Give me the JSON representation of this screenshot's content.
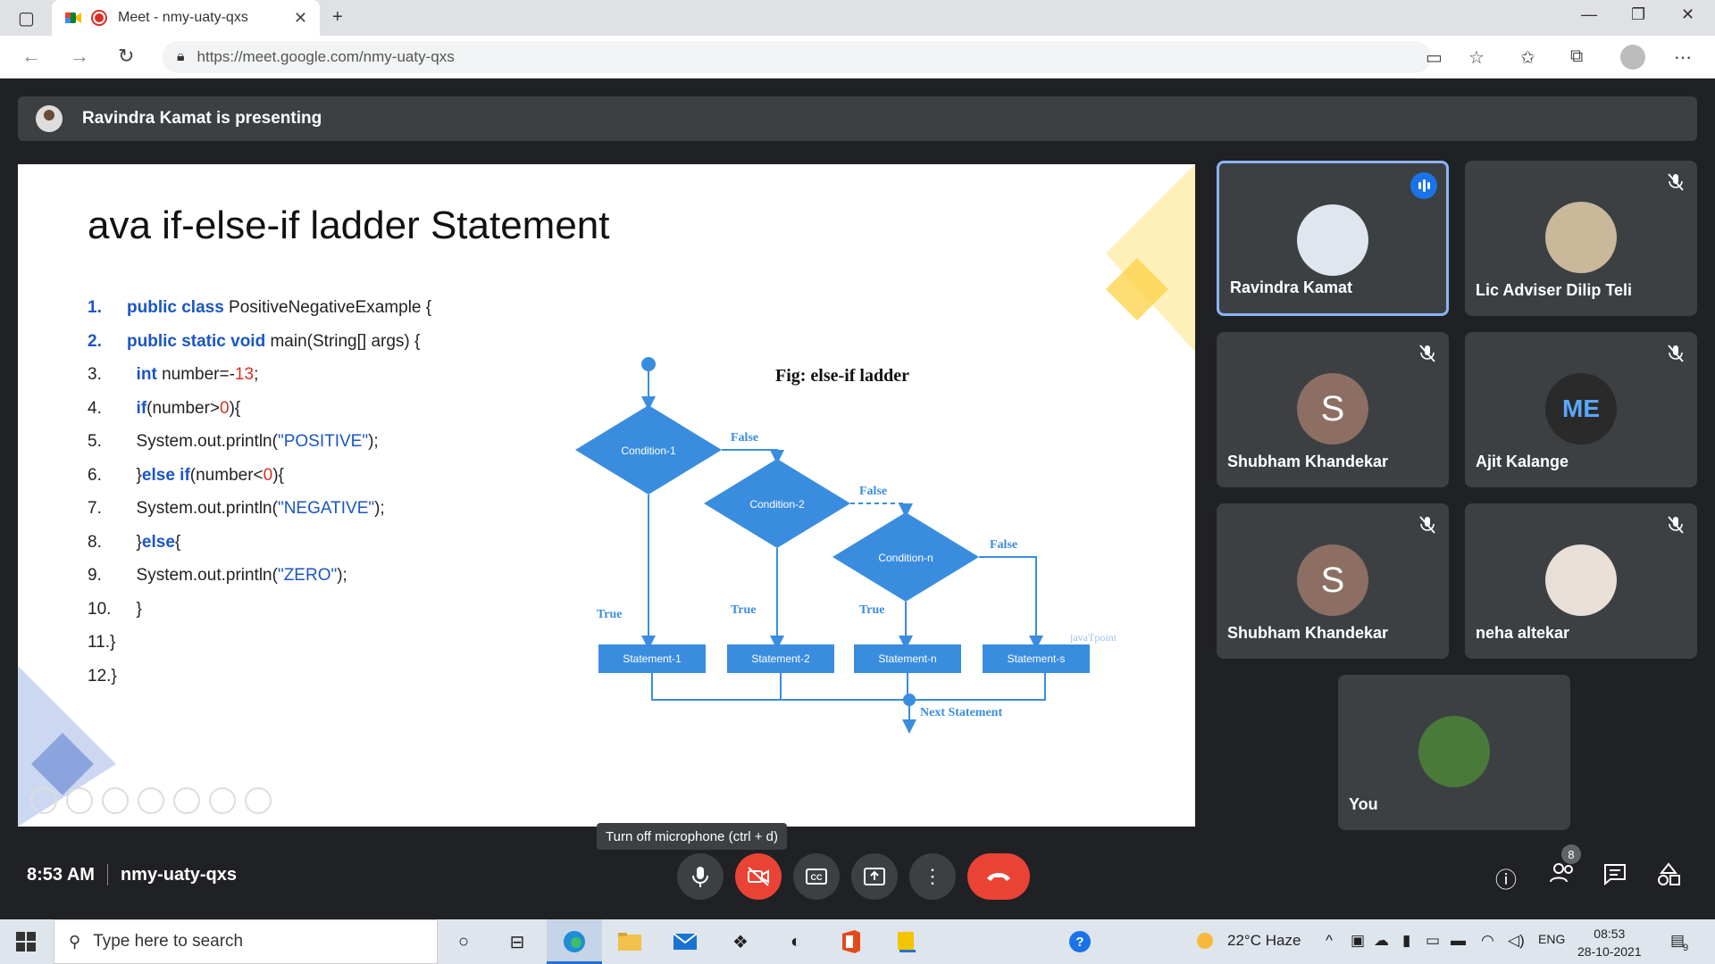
{
  "browser": {
    "tab_title": "Meet - nmy-uaty-qxs",
    "url": "https://meet.google.com/nmy-uaty-qxs"
  },
  "presenting_banner": "Ravindra Kamat is presenting",
  "slide": {
    "title": "ava if-else-if ladder Statement",
    "code": [
      {
        "n": "1.",
        "parts": [
          {
            "t": "public class ",
            "c": "kw"
          },
          {
            "t": "PositiveNegativeExample {",
            "c": ""
          }
        ]
      },
      {
        "n": "2.",
        "parts": [
          {
            "t": "public static void ",
            "c": "kw"
          },
          {
            "t": "main(String[] args) {",
            "c": ""
          }
        ]
      },
      {
        "n": "3.",
        "parts": [
          {
            "t": "  int ",
            "c": "kw"
          },
          {
            "t": "number=-",
            "c": ""
          },
          {
            "t": "13",
            "c": "num"
          },
          {
            "t": ";",
            "c": ""
          }
        ]
      },
      {
        "n": "4.",
        "parts": [
          {
            "t": "  if",
            "c": "kw"
          },
          {
            "t": "(number>",
            "c": ""
          },
          {
            "t": "0",
            "c": "num"
          },
          {
            "t": "){",
            "c": ""
          }
        ]
      },
      {
        "n": "5.",
        "parts": [
          {
            "t": "  System.out.println(",
            "c": ""
          },
          {
            "t": "\"POSITIVE\"",
            "c": "str"
          },
          {
            "t": ");",
            "c": ""
          }
        ]
      },
      {
        "n": "6.",
        "parts": [
          {
            "t": "  }",
            "c": ""
          },
          {
            "t": "else if",
            "c": "kw"
          },
          {
            "t": "(number<",
            "c": ""
          },
          {
            "t": "0",
            "c": "num"
          },
          {
            "t": "){",
            "c": ""
          }
        ]
      },
      {
        "n": "7.",
        "parts": [
          {
            "t": "  System.out.println(",
            "c": ""
          },
          {
            "t": "\"NEGATIVE\"",
            "c": "str"
          },
          {
            "t": ");",
            "c": ""
          }
        ]
      },
      {
        "n": "8.",
        "parts": [
          {
            "t": "  }",
            "c": ""
          },
          {
            "t": "else",
            "c": "kw"
          },
          {
            "t": "{",
            "c": ""
          }
        ]
      },
      {
        "n": "9.",
        "parts": [
          {
            "t": "  System.out.println(",
            "c": ""
          },
          {
            "t": "\"ZERO\"",
            "c": "str"
          },
          {
            "t": ");",
            "c": ""
          }
        ]
      },
      {
        "n": "10.",
        "parts": [
          {
            "t": "  }",
            "c": ""
          }
        ]
      },
      {
        "n": "11.}",
        "parts": []
      },
      {
        "n": "12.}",
        "parts": []
      }
    ],
    "figure": {
      "title": "Fig: else-if ladder",
      "conditions": [
        "Condition-1",
        "Condition-2",
        "Condition-n"
      ],
      "statements": [
        "Statement-1",
        "Statement-2",
        "Statement-n",
        "Statement-s"
      ],
      "false_label": "False",
      "true_label": "True",
      "next_label": "Next Statement",
      "watermark": "javaTpoint"
    }
  },
  "participants": [
    {
      "name": "Ravindra Kamat",
      "speaking": true,
      "avatar_color": "#dfe6ee",
      "initial": ""
    },
    {
      "name": "Lic Adviser Dilip Teli",
      "muted": true,
      "avatar_color": "#c9b89a",
      "initial": ""
    },
    {
      "name": "Shubham Khandekar",
      "muted": true,
      "avatar_color": "#8d6e63",
      "initial": "S"
    },
    {
      "name": "Ajit Kalange",
      "muted": true,
      "avatar_color": "#2a2a2a",
      "initial": "ME"
    },
    {
      "name": "Shubham Khandekar",
      "muted": true,
      "avatar_color": "#8d6e63",
      "initial": "S"
    },
    {
      "name": "neha altekar",
      "muted": true,
      "avatar_color": "#e8e0d8",
      "initial": ""
    },
    {
      "name": "You",
      "avatar_color": "#4a7a3a",
      "initial": ""
    }
  ],
  "controls": {
    "tooltip": "Turn off microphone (ctrl + d)",
    "time": "8:53 AM",
    "meeting_code": "nmy-uaty-qxs",
    "people_count": "8"
  },
  "taskbar": {
    "search_placeholder": "Type here to search",
    "weather": "22°C  Haze",
    "language": "ENG",
    "time": "08:53",
    "date": "28-10-2021",
    "notification_count": "9"
  },
  "colors": {
    "accent": "#1a73e8",
    "danger": "#ea4335",
    "diagram_blue": "#3a8dde"
  }
}
